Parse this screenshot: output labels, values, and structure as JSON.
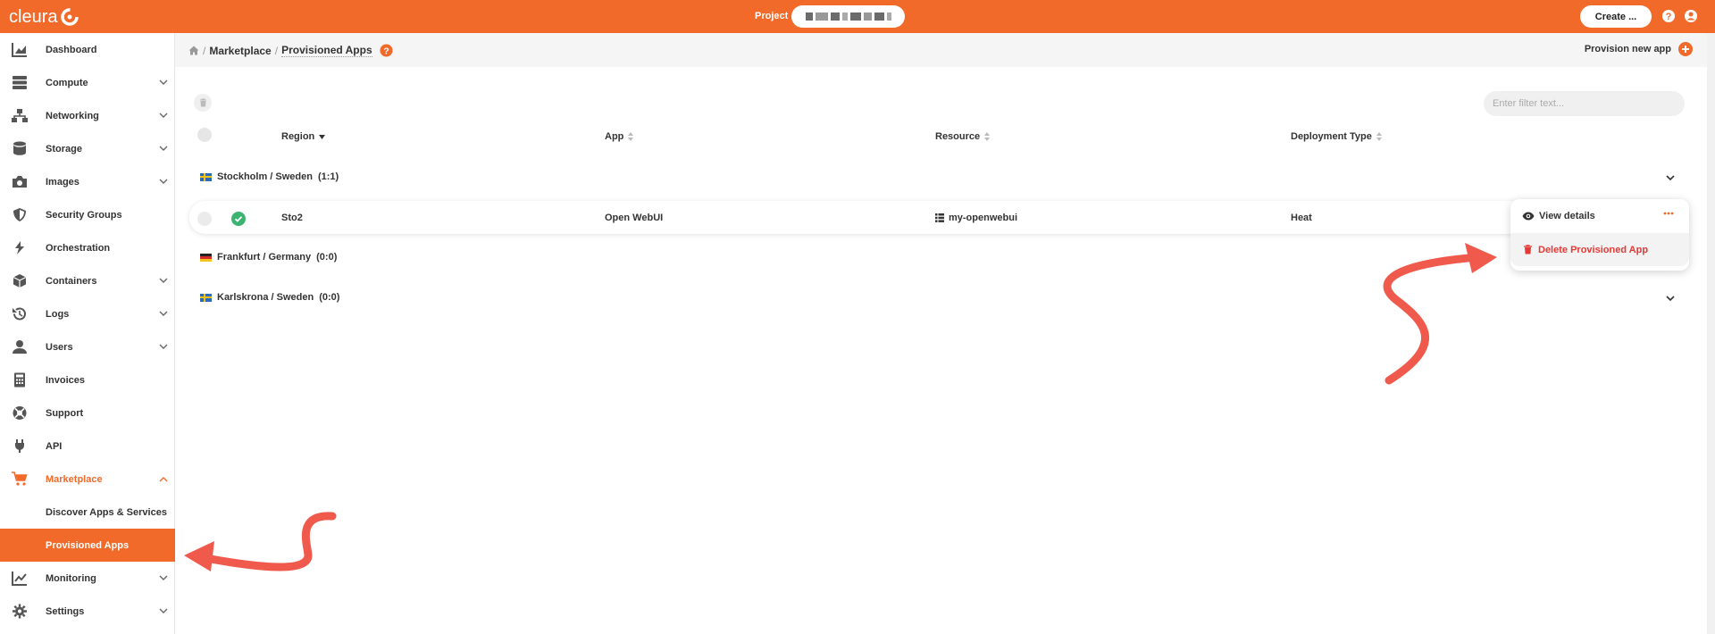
{
  "app": {
    "brand": "cleura",
    "accent": "#f26a2a"
  },
  "topbar": {
    "project_label": "Project",
    "create_label": "Create ..."
  },
  "sidebar": {
    "items": [
      {
        "label": "Dashboard",
        "icon": "chart-area-icon"
      },
      {
        "label": "Compute",
        "icon": "server-icon"
      },
      {
        "label": "Networking",
        "icon": "network-icon"
      },
      {
        "label": "Storage",
        "icon": "database-icon"
      },
      {
        "label": "Images",
        "icon": "camera-icon"
      },
      {
        "label": "Security Groups",
        "icon": "shield-icon"
      },
      {
        "label": "Orchestration",
        "icon": "orchestration-icon"
      },
      {
        "label": "Containers",
        "icon": "cube-icon"
      },
      {
        "label": "Logs",
        "icon": "history-icon"
      },
      {
        "label": "Users",
        "icon": "user-icon"
      },
      {
        "label": "Invoices",
        "icon": "calculator-icon"
      },
      {
        "label": "Support",
        "icon": "lifebuoy-icon"
      },
      {
        "label": "API",
        "icon": "plug-icon"
      },
      {
        "label": "Marketplace",
        "icon": "cart-icon"
      },
      {
        "label": "Discover Apps & Services"
      },
      {
        "label": "Provisioned Apps"
      },
      {
        "label": "Monitoring",
        "icon": "chart-line-icon"
      },
      {
        "label": "Settings",
        "icon": "gear-icon"
      }
    ]
  },
  "breadcrumb": {
    "items": [
      "Marketplace",
      "Provisioned Apps"
    ]
  },
  "toolbar": {
    "provision_label": "Provision new app",
    "filter_placeholder": "Enter filter text..."
  },
  "table": {
    "headers": [
      "Region",
      "App",
      "Resource",
      "Deployment Type"
    ],
    "groups": [
      {
        "name": "Stockholm / Sweden",
        "count": "(1:1)"
      },
      {
        "name": "Frankfurt / Germany",
        "count": "(0:0)"
      },
      {
        "name": "Karlskrona / Sweden",
        "count": "(0:0)"
      }
    ],
    "rows": [
      {
        "region": "Sto2",
        "app": "Open WebUI",
        "resource": "my-openwebui",
        "deployment": "Heat"
      }
    ]
  },
  "dropdown": {
    "view_label": "View details",
    "delete_label": "Delete Provisioned App"
  }
}
